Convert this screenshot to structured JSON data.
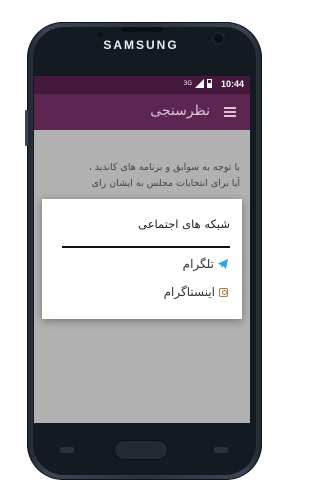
{
  "device": {
    "brand": "SAMSUNG"
  },
  "status_bar": {
    "time": "10:44",
    "network": "3G"
  },
  "app_bar": {
    "title": "نظرسنجی"
  },
  "content": {
    "question_line1": "با توجه به سوابق و برنامه های کاندید ،",
    "question_line2": "آیا برای انتخابات مجلس به ایشان رای"
  },
  "dialog": {
    "title": "شبکه های اجتماعی",
    "options": [
      {
        "label": "تلگرام",
        "icon": "telegram-icon"
      },
      {
        "label": "اینستاگرام",
        "icon": "instagram-icon"
      }
    ]
  },
  "colors": {
    "status_bar": "#44193d",
    "app_bar": "#5d2652"
  }
}
